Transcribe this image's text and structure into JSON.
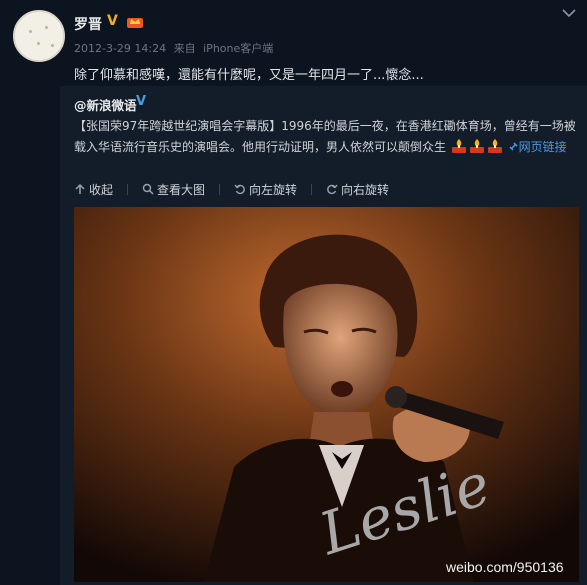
{
  "user": {
    "name": "罗晋",
    "timestamp": "2012-3-29 14:24",
    "source_prefix": "来自",
    "source": "iPhone客户端",
    "post_text": "除了仰慕和感嘆，還能有什麼呢，又是一年四月一了...懷念..."
  },
  "repost": {
    "author": "@新浪微语",
    "text_before": "【张国荣97年跨越世纪演唱会字幕版】1996年的最后一夜，在香港红磡体育场，曾经有一场被载入华语流行音乐史的演唱会。他用行动证明，男人依然可以颠倒众生",
    "link_label": "网页链接",
    "actions": {
      "collapse": "收起",
      "view_large": "查看大图",
      "rotate_left": "向左旋转",
      "rotate_right": "向右旋转"
    },
    "photo_signature": "Leslie",
    "watermark": "weibo.com/950136"
  },
  "colors": {
    "background": "#0c1420",
    "repost_background": "#131d2a",
    "verified_gold": "#f2b01e",
    "verified_blue": "#4c9be0",
    "link": "#4c9be0"
  },
  "icons": [
    "verified-badge-icon",
    "vip-crown-icon",
    "chevron-down-icon",
    "candle-emoji-icon",
    "link-icon",
    "collapse-icon",
    "zoom-icon",
    "rotate-left-icon",
    "rotate-right-icon"
  ]
}
